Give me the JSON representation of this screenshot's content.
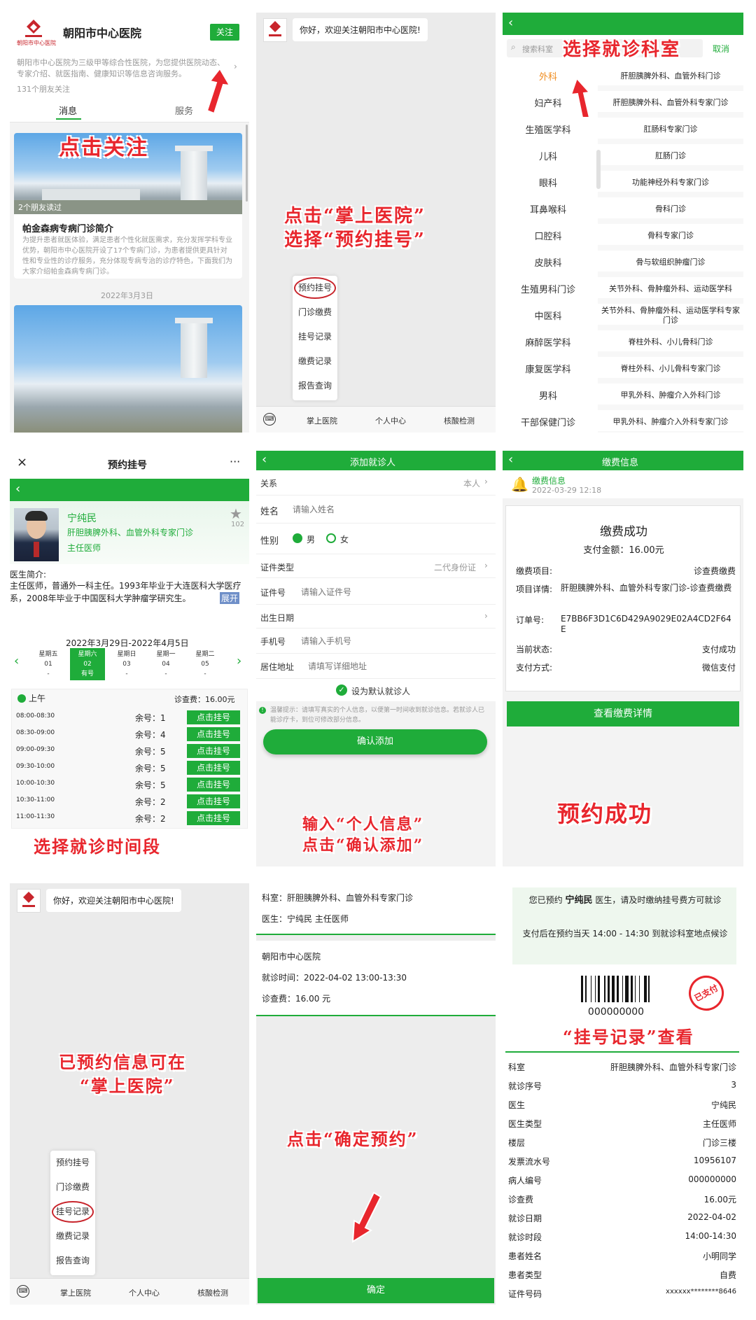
{
  "p1": {
    "hospital_name": "朝阳市中心医院",
    "logo_text": "朝阳市中心医院",
    "follow_button": "关注",
    "intro": "朝阳市中心医院为三级甲等综合性医院，为您提供医院动态、专家介绍、就医指南、健康知识等信息咨询服务。",
    "friends": "131个朋友关注",
    "tab_messages": "消息",
    "tab_services": "服务",
    "annotation": "点击关注",
    "article_overlay": "2个朋友读过",
    "article_title": "帕金森病专病门诊简介",
    "article_body": "为提升患者就医体验，满足患者个性化就医需求，充分发挥学科专业优势，朝阳市中心医院开设了17个专病门诊，为患者提供更具针对性和专业性的诊疗服务，充分体现专病专治的诊疗特色，下面我们为大家介绍帕金森病专病门诊。",
    "article_date": "2022年3月3日"
  },
  "p2": {
    "welcome": "你好，欢迎关注朝阳市中心医院!",
    "annotation_line1": "点击“掌上医院”",
    "annotation_line2": "选择“预约挂号”",
    "menu": [
      "预约挂号",
      "门诊缴费",
      "挂号记录",
      "缴费记录",
      "报告查询"
    ],
    "bottom_tabs": [
      "掌上医院",
      "个人中心",
      "核酸检测"
    ]
  },
  "p3": {
    "search_placeholder": "搜索科室",
    "cancel": "取消",
    "annotation": "选择就诊科室",
    "departments": [
      "外科",
      "妇产科",
      "生殖医学科",
      "儿科",
      "眼科",
      "耳鼻喉科",
      "口腔科",
      "皮肤科",
      "生殖男科门诊",
      "中医科",
      "麻醉医学科",
      "康复医学科",
      "男科",
      "干部保健门诊"
    ],
    "clinics": [
      "肝胆胰脾外科、血管外科门诊",
      "肝胆胰脾外科、血管外科专家门诊",
      "肛肠科专家门诊",
      "肛肠门诊",
      "功能神经外科专家门诊",
      "骨科门诊",
      "骨科专家门诊",
      "骨与软组织肿瘤门诊",
      "关节外科、骨肿瘤外科、运动医学科",
      "关节外科、骨肿瘤外科、运动医学科专家门诊",
      "脊柱外科、小儿骨科门诊",
      "脊柱外科、小儿骨科专家门诊",
      "甲乳外科、肿瘤介入外科门诊",
      "甲乳外科、肿瘤介入外科专家门诊"
    ]
  },
  "p4": {
    "title": "预约挂号",
    "more": "···",
    "close": "×",
    "doctor_name": "宁纯民",
    "doctor_dept": "肝胆胰脾外科、血管外科专家门诊",
    "doctor_title": "主任医师",
    "star_count": "102",
    "intro_label": "医生简介:",
    "intro_text": "主任医师，普通外一科主任。1993年毕业于大连医科大学医疗系，2008年毕业于中国医科大学肿瘤学研究生。",
    "expand": "展开",
    "date_range": "2022年3月29日-2022年4月5日",
    "days": [
      {
        "week": "星期五",
        "day": "01",
        "status": "-"
      },
      {
        "week": "星期六",
        "day": "02",
        "status": "有号"
      },
      {
        "week": "星期日",
        "day": "03",
        "status": "-"
      },
      {
        "week": "星期一",
        "day": "04",
        "status": "-"
      },
      {
        "week": "星期二",
        "day": "05",
        "status": "-"
      }
    ],
    "session": "上午",
    "fee": "诊查费：16.00元",
    "slots": [
      {
        "time": "08:00-08:30",
        "left": "余号：1",
        "btn": "点击挂号"
      },
      {
        "time": "08:30-09:00",
        "left": "余号：4",
        "btn": "点击挂号"
      },
      {
        "time": "09:00-09:30",
        "left": "余号：5",
        "btn": "点击挂号"
      },
      {
        "time": "09:30-10:00",
        "left": "余号：5",
        "btn": "点击挂号"
      },
      {
        "time": "10:00-10:30",
        "left": "余号：5",
        "btn": "点击挂号"
      },
      {
        "time": "10:30-11:00",
        "left": "余号：2",
        "btn": "点击挂号"
      },
      {
        "time": "11:00-11:30",
        "left": "余号：2",
        "btn": "点击挂号"
      }
    ],
    "annotation": "选择就诊时间段"
  },
  "p5": {
    "title": "添加就诊人",
    "relation_label": "关系",
    "relation_value": "本人",
    "name_label": "姓名",
    "name_placeholder": "请输入姓名",
    "gender_label": "性别",
    "male": "男",
    "female": "女",
    "id_type_label": "证件类型",
    "id_type_value": "二代身份证",
    "id_label": "证件号",
    "id_placeholder": "请输入证件号",
    "birth_label": "出生日期",
    "phone_label": "手机号",
    "phone_placeholder": "请输入手机号",
    "address_label": "居住地址",
    "address_placeholder": "请填写详细地址",
    "default_label": "设为默认就诊人",
    "tip": "温馨提示：请填写真实的个人信息，以便第一时间收到就诊信息。若就诊人已能诊疗卡，到位可修改部分信息。",
    "confirm": "确认添加",
    "annotation_line1": "输入“个人信息”",
    "annotation_line2": "点击“确认添加”"
  },
  "p6": {
    "title": "缴费信息",
    "notice_title": "缴费信息",
    "notice_time": "2022-03-29 12:18",
    "success": "缴费成功",
    "amount": "支付金额：16.00元",
    "rows": [
      {
        "label": "缴费项目:",
        "value": "诊查费缴费"
      },
      {
        "label": "项目详情:",
        "value": "肝胆胰脾外科、血管外科专家门诊-诊查费缴费"
      },
      {
        "label": "订单号:",
        "value": "E7BB6F3D1C6D429A9029E02A4CD2F64E"
      },
      {
        "label": "当前状态:",
        "value": "支付成功"
      },
      {
        "label": "支付方式:",
        "value": "微信支付"
      }
    ],
    "detail_button": "查看缴费详情",
    "annotation": "预约成功"
  },
  "p7": {
    "welcome": "你好，欢迎关注朝阳市中心医院!",
    "annotation_line1": "已预约信息可在",
    "annotation_line2": "“掌上医院”",
    "menu": [
      "预约挂号",
      "门诊缴费",
      "挂号记录",
      "缴费记录",
      "报告查询"
    ],
    "bottom_tabs": [
      "掌上医院",
      "个人中心",
      "核酸检测"
    ]
  },
  "p8": {
    "dept": "科室：肝胆胰脾外科、血管外科专家门诊",
    "doctor": "医生：宁纯民 主任医师",
    "hospital": "朝阳市中心医院",
    "time": "就诊时间：2022-04-02 13:00-13:30",
    "fee": "诊查费：16.00 元",
    "annotation": "点击“确定预约”",
    "confirm": "确定"
  },
  "p9": {
    "notice1_pre": "您已预约",
    "notice1_name": "宁纯民",
    "notice1_post": "医生，请及时缴纳挂号费方可就诊",
    "notice2": "支付后在预约当天 14:00 - 14:30 到就诊科室地点候诊",
    "stamp": "已支付",
    "barcode_number": "000000000",
    "annotation": "“挂号记录”查看",
    "rows": [
      {
        "label": "科室",
        "value": "肝胆胰脾外科、血管外科专家门诊"
      },
      {
        "label": "就诊序号",
        "value": "3"
      },
      {
        "label": "医生",
        "value": "宁纯民"
      },
      {
        "label": "医生类型",
        "value": "主任医师"
      },
      {
        "label": "楼层",
        "value": "门诊三楼"
      },
      {
        "label": "发票流水号",
        "value": "10956107"
      },
      {
        "label": "病人编号",
        "value": "000000000"
      },
      {
        "label": "诊查费",
        "value": "16.00元"
      },
      {
        "label": "就诊日期",
        "value": "2022-04-02"
      },
      {
        "label": "就诊时段",
        "value": "14:00-14:30"
      },
      {
        "label": "患者姓名",
        "value": "小明同学"
      },
      {
        "label": "患者类型",
        "value": "自费"
      },
      {
        "label": "证件号码",
        "value": "xxxxxx********8646"
      }
    ]
  },
  "colors": {
    "green": "#1fac3a",
    "red": "#e8262d",
    "orange": "#f08c1e"
  }
}
